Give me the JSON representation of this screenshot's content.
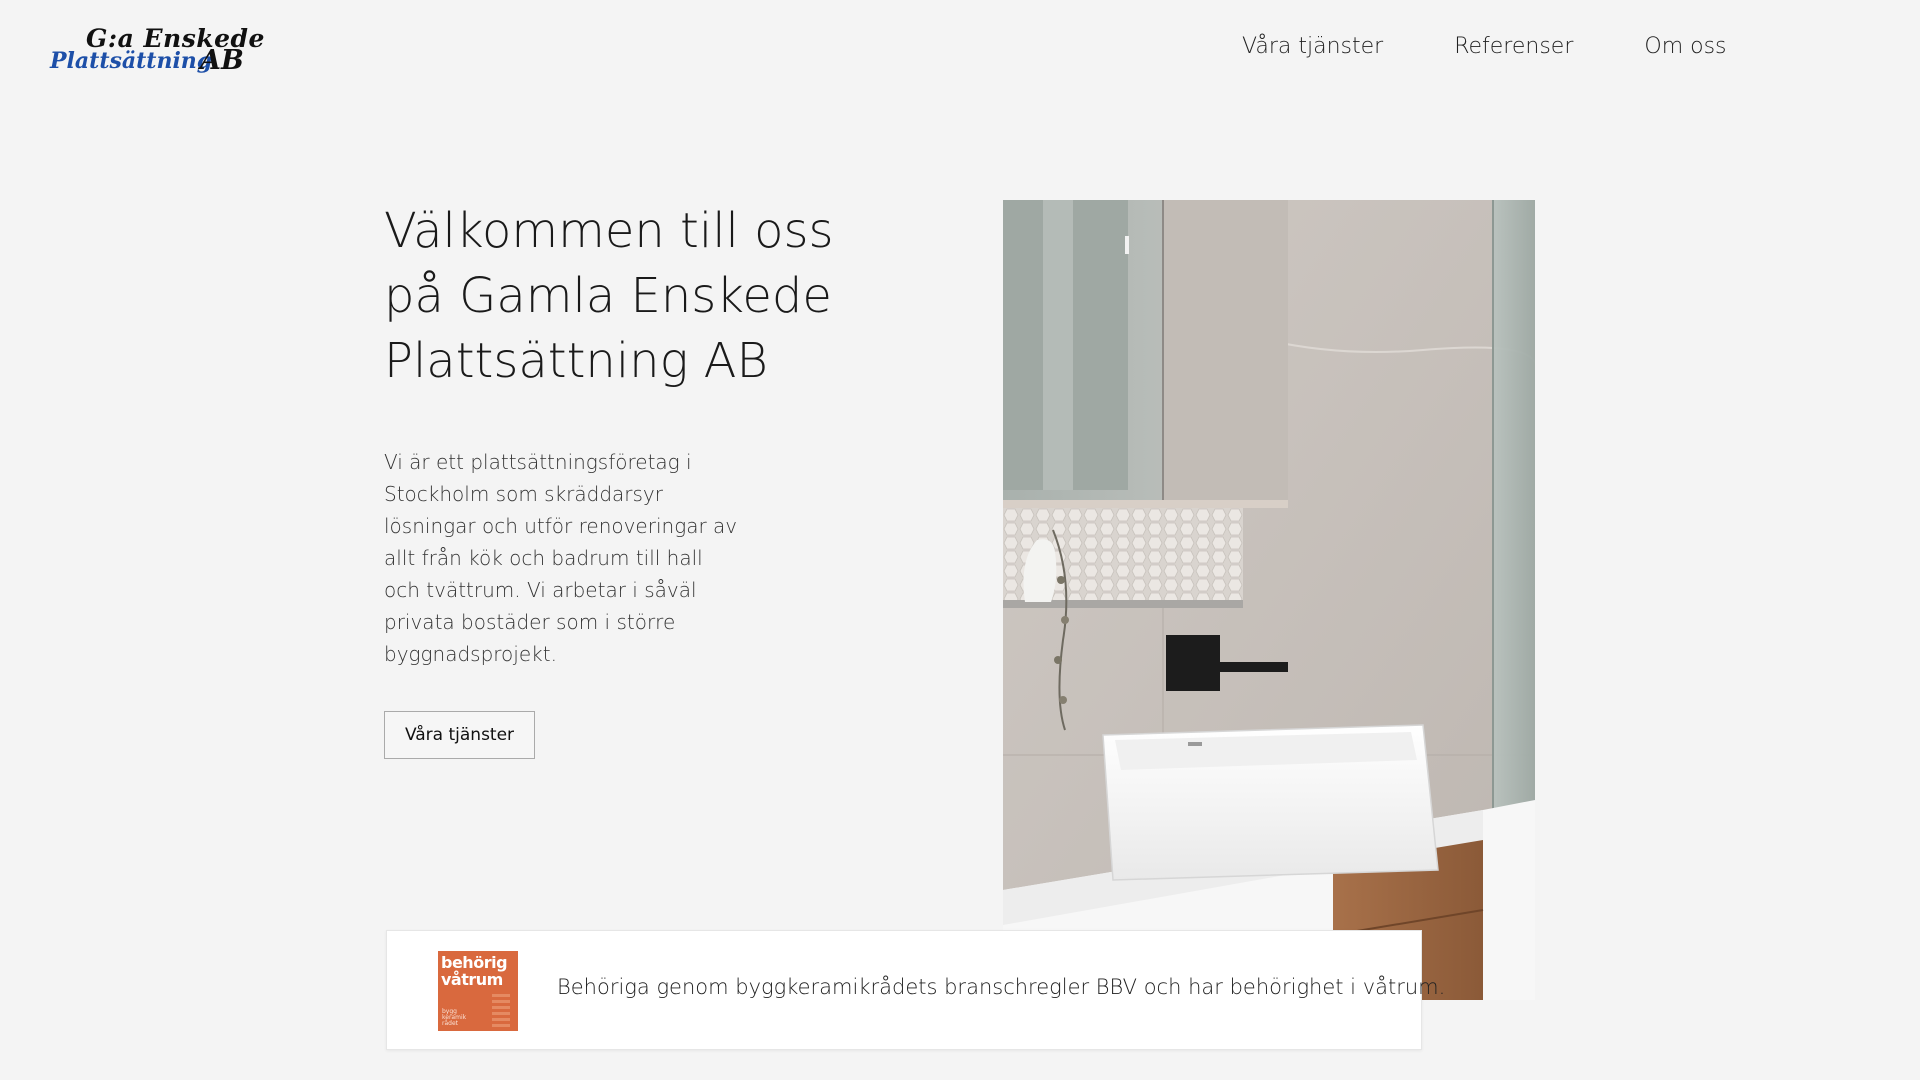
{
  "header": {
    "logo": {
      "line1": "G:a Enskede",
      "line2a": "Plattsättning",
      "line2b": "AB"
    },
    "nav": [
      {
        "label": "Våra tjänster"
      },
      {
        "label": "Referenser"
      },
      {
        "label": "Om oss"
      }
    ]
  },
  "hero": {
    "title": "Välkommen till oss på Gamla Enskede Plattsättning AB",
    "text": "Vi är ett plattsättningsföretag i Stockholm som skräddarsyr lösningar och utför renoveringar av allt från kök och badrum till hall och tvättrum. Vi arbetar i såväl privata bostäder som i större byggnadsprojekt.",
    "cta_label": "Våra tjänster"
  },
  "badge_card": {
    "badge": {
      "line1": "behörig",
      "line2": "våtrum",
      "small": "bygg keramik rådet"
    },
    "text": "Behöriga genom byggkeramikrådets branschregler BBV och har behörighet i våtrum."
  },
  "colors": {
    "background": "#f4f4f4",
    "logo_blue": "#1d4fa8",
    "badge_orange": "#d9693e"
  }
}
